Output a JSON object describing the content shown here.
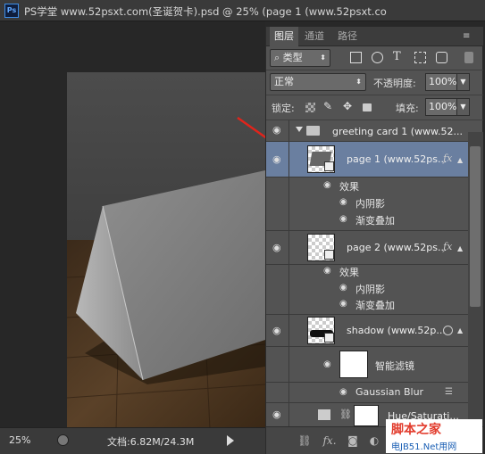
{
  "app": {
    "logo": "Ps"
  },
  "window": {
    "title": "PS学堂 www.52psxt.com(圣诞贺卡).psd @ 25% (page 1 (www.52psxt.co"
  },
  "status": {
    "zoom": "25%",
    "doc_info": "文档:6.82M/24.3M"
  },
  "panel": {
    "tabs": [
      "图层",
      "通道",
      "路径"
    ],
    "filter": {
      "kind_label": "类型"
    },
    "blend_mode": "正常",
    "opacity_label": "不透明度:",
    "opacity_value": "100%",
    "lock_label": "锁定:",
    "fill_label": "填充:",
    "fill_value": "100%"
  },
  "layers": {
    "group": {
      "name": "greeting card 1 (www.52..."
    },
    "page1": {
      "name": "page 1 (www.52ps...",
      "fx": "fx",
      "effects_label": "效果",
      "effects": [
        "内阴影",
        "渐变叠加"
      ]
    },
    "page2": {
      "name": "page 2 (www.52ps...",
      "fx": "fx",
      "effects_label": "效果",
      "effects": [
        "内阴影",
        "渐变叠加"
      ]
    },
    "shadow": {
      "name": "shadow (www.52p...",
      "smart_filters_label": "智能滤镜",
      "filter_name": "Gaussian Blur"
    },
    "adjust": {
      "name": "Hue/Saturati..."
    }
  },
  "watermark": {
    "line1": "脚本之家",
    "line2": "电JB51.Net用网"
  },
  "colors": {
    "accent": "#e0241b",
    "selected_row": "#6a7fa0",
    "panel_bg": "#535353"
  }
}
